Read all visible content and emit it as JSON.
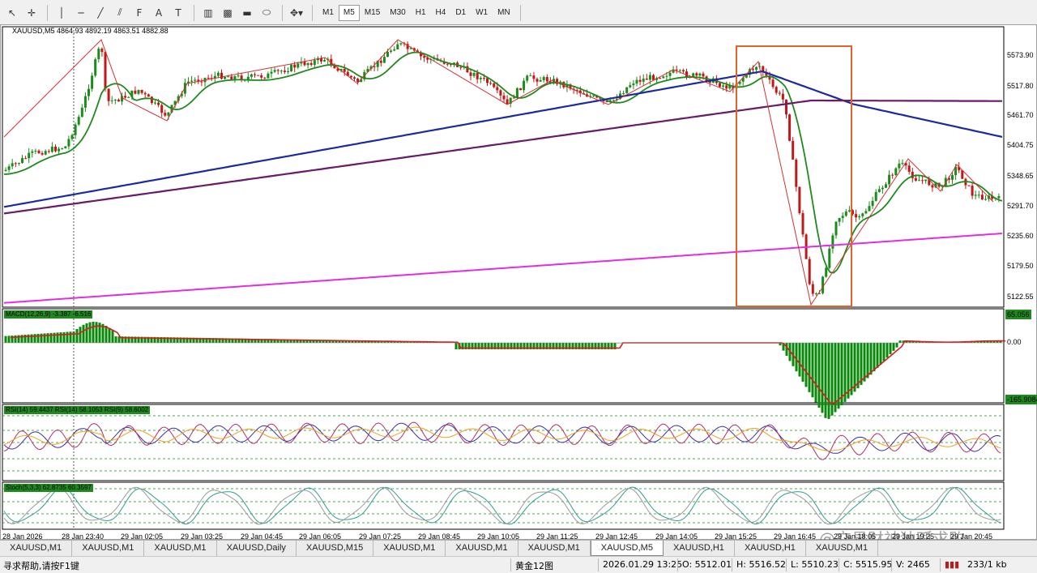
{
  "toolbar": {
    "tools": [
      {
        "icon": "cursor-icon",
        "glyph": "↖"
      },
      {
        "icon": "crosshair-icon",
        "glyph": "✛"
      },
      {
        "icon": "vertical-line-icon",
        "glyph": "│"
      },
      {
        "icon": "horizontal-line-icon",
        "glyph": "─"
      },
      {
        "icon": "trendline-icon",
        "glyph": "╱"
      },
      {
        "icon": "equidistant-channel-icon",
        "glyph": "⫽"
      },
      {
        "icon": "fibonacci-icon",
        "glyph": "F"
      },
      {
        "icon": "text-icon",
        "glyph": "A"
      },
      {
        "icon": "text-label-icon",
        "glyph": "T"
      },
      {
        "icon": "grid-icon",
        "glyph": "▥"
      },
      {
        "icon": "gann-grid-icon",
        "glyph": "▩"
      },
      {
        "icon": "rectangle-icon",
        "glyph": "▬"
      },
      {
        "icon": "ellipse-icon",
        "glyph": "⬭"
      },
      {
        "icon": "arrows-icon",
        "glyph": "✥▾"
      }
    ],
    "timeframes": [
      "M1",
      "M5",
      "M15",
      "M30",
      "H1",
      "H4",
      "D1",
      "W1",
      "MN"
    ],
    "active_timeframe": "M5"
  },
  "chart": {
    "title": "XAUUSD,M5  4864.93 4892.19 4863.51 4882.88",
    "price_levels": [
      "5573.90",
      "5517.80",
      "5461.70",
      "5404.75",
      "5348.65",
      "5291.70",
      "5235.60",
      "5179.50",
      "5122.55"
    ],
    "macd_label": "MACD(12,26,9) -3.387 -6.516",
    "macd_high": "65.056",
    "macd_zero": "0.00",
    "macd_low": "-165.9084",
    "rsi_label": "RSI(14) 59.4437  RSI(14) 58.1053  RSI(9) 58.6002",
    "rsi_levels": [
      "90",
      "70",
      "50",
      "30",
      "10"
    ],
    "stoch_label": "Stoch(5,3,3) 62.8735 60.3597",
    "stoch_levels": [
      "100",
      "80",
      "20",
      "0"
    ],
    "time_labels": [
      "28 Jan 2026",
      "28 Jan 23:40",
      "29 Jan 02:05",
      "29 Jan 03:25",
      "29 Jan 04:45",
      "29 Jan 06:05",
      "29 Jan 07:25",
      "29 Jan 08:45",
      "29 Jan 10:05",
      "29 Jan 11:25",
      "29 Jan 12:45",
      "29 Jan 14:05",
      "29 Jan 15:25",
      "29 Jan 16:45",
      "29 Jan 18:05",
      "29 Jan 19:25",
      "29 Jan 20:45"
    ],
    "watermark": "@交易财神独孤求败",
    "colors": {
      "bull": "#1a8c1a",
      "bear": "#c01818",
      "ma_fast": "#1e8a1e",
      "ma_mid": "#1b2aa0",
      "ma_slow": "#6a1a6a",
      "ma_long": "#e02ee0",
      "zigzag": "#d03030",
      "highlight_box": "#e0632a"
    }
  },
  "tabs": [
    "XAUUSD,M1",
    "XAUUSD,M1",
    "XAUUSD,M1",
    "XAUUSD,Daily",
    "XAUUSD,M15",
    "XAUUSD,M1",
    "XAUUSD,M1",
    "XAUUSD,M1",
    "XAUUSD,M5",
    "XAUUSD,H1",
    "XAUUSD,H1",
    "XAUUSD,M1"
  ],
  "active_tab_index": 8,
  "status": {
    "help": "寻求帮助,请按F1键",
    "profile": "黄金12图",
    "datetime": "2026.01.29 13:25",
    "open": "O: 5512.01",
    "high": "H: 5516.52",
    "low": "L: 5510.23",
    "close": "C: 5515.95",
    "volume": "V: 2465",
    "traffic": "233/1 kb"
  }
}
